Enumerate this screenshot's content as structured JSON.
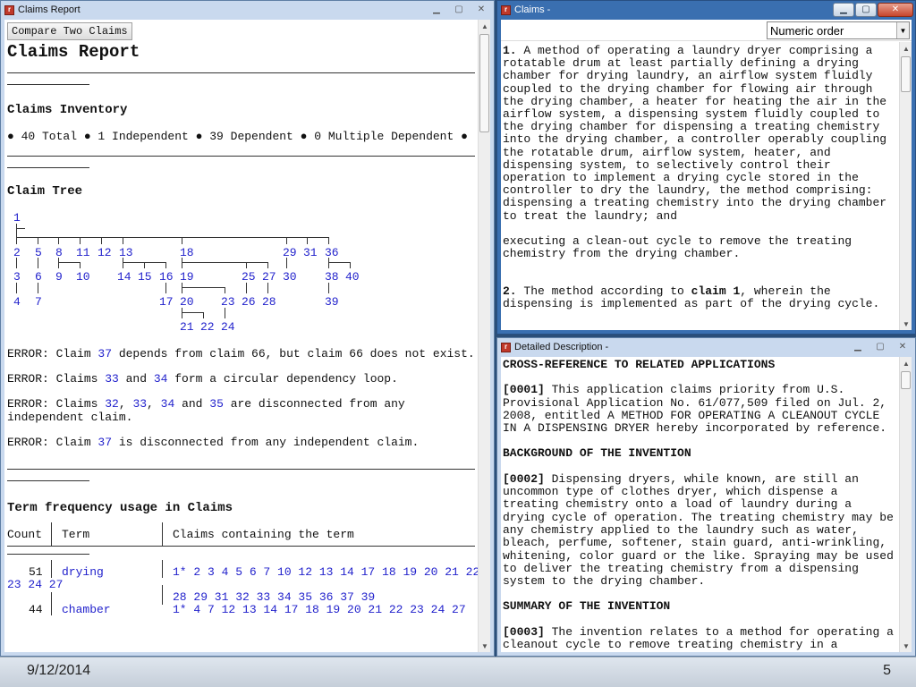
{
  "report_window": {
    "title": "Claims Report",
    "compare_button": "Compare Two Claims",
    "heading": "Claims Report",
    "inventory_heading": "Claims Inventory",
    "inventory_line": "● 40 Total ● 1 Independent ● 39 Dependent ● 0 Multiple Dependent ●",
    "tree_heading": "Claim Tree",
    "tree_nodes": [
      "1",
      "2",
      "5",
      "8",
      "11",
      "12",
      "13",
      "18",
      "29",
      "31",
      "36",
      "3",
      "6",
      "9",
      "10",
      "14",
      "15",
      "16",
      "19",
      "25",
      "27",
      "30",
      "38",
      "40",
      "4",
      "7",
      "17",
      "20",
      "23",
      "26",
      "28",
      "39",
      "21",
      "22",
      "24"
    ],
    "errors": [
      {
        "pre": "ERROR: Claim ",
        "l1": "37",
        "mid": " depends from claim 66, but claim 66 does not exist."
      },
      {
        "pre": "ERROR: Claims ",
        "l1": "33",
        "mid": " and ",
        "l2": "34",
        "post": " form a circular dependency loop."
      },
      {
        "pre": "ERROR: Claims ",
        "l1": "32",
        "mid": ", ",
        "l2": "33",
        "mid2": ", ",
        "l3": "34",
        "mid3": " and ",
        "l4": "35",
        "post": " are disconnected from any independent claim."
      },
      {
        "pre": "ERROR: Claim ",
        "l1": "37",
        "mid": " is disconnected from any independent claim."
      }
    ],
    "term_heading": "Term frequency usage in Claims",
    "term_cols": [
      "Count",
      "Term",
      "Claims containing the term"
    ],
    "term_rows": [
      {
        "count": "51",
        "term": "drying",
        "claims_line1": "1* 2 3 4 5 6 7 10 12 13 14 17 18 19 20 21 22",
        "claims_wrap": "23 24 27",
        "claims_line2": "28 29 31 32 33 34 35 36 37 39"
      },
      {
        "count": "44",
        "term": "chamber",
        "claims_line1": "1* 4 7 12 13 14 17 18 19 20 21 22 23 24 27"
      }
    ]
  },
  "claims_window": {
    "title": "Claims -",
    "sort_select": "Numeric order",
    "claim1_num": "1.",
    "claim1_text": "A method of operating a laundry dryer comprising a rotatable drum at least partially defining a drying chamber for drying laundry, an airflow system fluidly coupled to the drying chamber for flowing air through the drying chamber, a heater for heating the air in the airflow system, a dispensing system fluidly coupled to the drying chamber for dispensing a treating chemistry into the drying chamber, a controller operably coupling the rotatable drum, airflow system, heater, and dispensing system, to selectively control their operation to implement a drying cycle stored in the controller to dry the laundry, the method comprising:",
    "claim1_step1": "dispensing a treating chemistry into the drying chamber to treat the laundry; and",
    "claim1_step2": "executing a clean-out cycle to remove the treating chemistry from the drying chamber.",
    "claim2_num": "2.",
    "claim2_pre": "The method according to ",
    "claim2_ref": "claim 1",
    "claim2_post": ", wherein the dispensing is implemented as part of the drying cycle."
  },
  "desc_window": {
    "title": "Detailed Description -",
    "h_cross": "CROSS-REFERENCE TO RELATED APPLICATIONS",
    "p1_num": "[0001]",
    "p1": "This application claims priority from U.S. Provisional Application No. 61/077,509 filed on Jul. 2, 2008, entitled A METHOD FOR OPERATING A CLEANOUT CYCLE IN A DISPENSING DRYER hereby incorporated by reference.",
    "h_background": "BACKGROUND OF THE INVENTION",
    "p2_num": "[0002]",
    "p2": "Dispensing dryers, while known, are still an uncommon type of clothes dryer, which dispense a treating chemistry onto a load of laundry during a drying cycle of operation. The treating chemistry may be any chemistry applied to the laundry such as water, bleach, perfume, softener, stain guard, anti-wrinkling, whitening, color guard or the like. Spraying may be used to deliver the treating chemistry from a dispensing system to the drying chamber.",
    "h_summary": "SUMMARY OF THE INVENTION",
    "p3_num": "[0003]",
    "p3": "The invention relates to a method for operating a cleanout cycle to remove treating chemistry in a"
  },
  "taskbar": {
    "date": "9/12/2014",
    "page": "5"
  }
}
